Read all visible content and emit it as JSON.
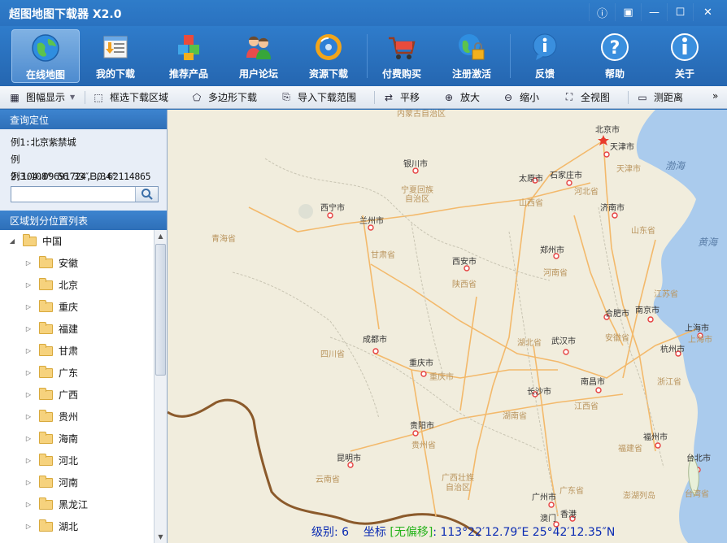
{
  "window": {
    "title": "超图地图下载器 X2.0"
  },
  "toolbar": [
    {
      "label": "在线地图",
      "icon": "globe-icon"
    },
    {
      "label": "我的下载",
      "icon": "download-list-icon"
    },
    {
      "label": "推荐产品",
      "icon": "cubes-icon"
    },
    {
      "label": "用户论坛",
      "icon": "users-icon"
    },
    {
      "label": "资源下载",
      "icon": "resource-disc-icon"
    },
    {
      "label": "付费购买",
      "icon": "shopping-cart-icon"
    },
    {
      "label": "注册激活",
      "icon": "globe-lock-icon"
    },
    {
      "label": "反馈",
      "icon": "info-bubble-icon"
    },
    {
      "label": "帮助",
      "icon": "help-icon"
    },
    {
      "label": "关于",
      "icon": "about-icon"
    }
  ],
  "subtoolbar": [
    {
      "label": "图幅显示",
      "icon": "grid-icon"
    },
    {
      "label": "框选下载区域",
      "icon": "rect-select-icon"
    },
    {
      "label": "多边形下载",
      "icon": "polygon-icon"
    },
    {
      "label": "导入下载范围",
      "icon": "import-icon"
    },
    {
      "label": "平移",
      "icon": "pan-icon"
    },
    {
      "label": "放大",
      "icon": "zoom-in-icon"
    },
    {
      "label": "缩小",
      "icon": "zoom-out-icon"
    },
    {
      "label": "全视图",
      "icon": "full-view-icon"
    },
    {
      "label": "测距离",
      "icon": "ruler-icon"
    }
  ],
  "query": {
    "title": "查询定位",
    "examples": [
      "例1:北京紫禁城",
      "例2:104.09691724,30.62114865",
      "例3:108° 56′33″E,34° 20′33″N"
    ],
    "search_value": ""
  },
  "region_list": {
    "title": "区域划分位置列表",
    "root": "中国",
    "items": [
      "安徽",
      "北京",
      "重庆",
      "福建",
      "甘肃",
      "广东",
      "广西",
      "贵州",
      "海南",
      "河北",
      "河南",
      "黑龙江",
      "湖北"
    ]
  },
  "map": {
    "cities": [
      "北京市",
      "天津市",
      "银川市",
      "太原市",
      "石家庄市",
      "西宁市",
      "兰州市",
      "济南市",
      "郑州市",
      "西安市",
      "合肥市",
      "南京市",
      "上海市",
      "成都市",
      "武汉市",
      "杭州市",
      "重庆市",
      "长沙市",
      "南昌市",
      "贵阳市",
      "福州市",
      "台北市",
      "昆明市",
      "广州市",
      "香港",
      "澳门"
    ],
    "provinces": [
      "内蒙古自治区",
      "宁夏回族自治区",
      "山西省",
      "河北省",
      "天津市",
      "青海省",
      "甘肃省",
      "山东省",
      "河南省",
      "陕西省",
      "江苏省",
      "安徽省",
      "上海市",
      "四川省",
      "湖北省",
      "浙江省",
      "重庆市",
      "湖南省",
      "江西省",
      "贵州省",
      "福建省",
      "台湾省",
      "云南省",
      "广西壮族自治区",
      "广东省",
      "澎湖列岛"
    ],
    "seas": [
      "渤海",
      "黄海"
    ]
  },
  "status": {
    "level_label": "级别:",
    "level_value": "6",
    "coord_label": "坐标",
    "offset_label": "[无偏移]",
    "coord_value": ": 113°22′12.79″E   25°42′12.35″N"
  }
}
